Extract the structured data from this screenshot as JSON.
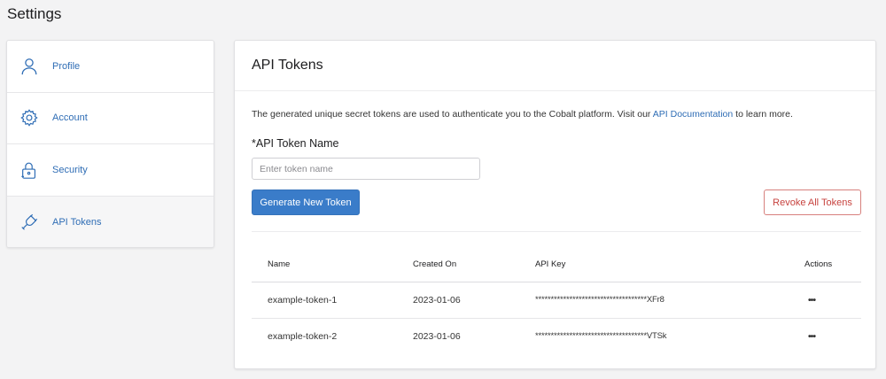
{
  "page": {
    "title": "Settings"
  },
  "sidebar": {
    "items": [
      {
        "label": "Profile",
        "icon": "user-icon",
        "active": false
      },
      {
        "label": "Account",
        "icon": "gear-icon",
        "active": false
      },
      {
        "label": "Security",
        "icon": "lock-icon",
        "active": false
      },
      {
        "label": "API Tokens",
        "icon": "plug-icon",
        "active": true
      }
    ]
  },
  "main": {
    "title": "API Tokens",
    "description_pre": "The generated unique secret tokens are used to authenticate you to the Cobalt platform. Visit our ",
    "description_link": "API Documentation",
    "description_post": " to learn more.",
    "field_label": "*API Token Name",
    "input_placeholder": "Enter token name",
    "input_value": "",
    "generate_button": "Generate New Token",
    "revoke_button": "Revoke All Tokens",
    "table": {
      "headers": {
        "name": "Name",
        "created": "Created On",
        "key": "API Key",
        "actions": "Actions"
      },
      "rows": [
        {
          "name": "example-token-1",
          "created": "2023-01-06",
          "key": "************************************XFr8",
          "actions": "•••"
        },
        {
          "name": "example-token-2",
          "created": "2023-01-06",
          "key": "************************************VTSk",
          "actions": "•••"
        }
      ]
    }
  },
  "colors": {
    "accent": "#3a7cc9",
    "link": "#2f6db5",
    "danger": "#c7433f",
    "background": "#f3f3f4"
  }
}
